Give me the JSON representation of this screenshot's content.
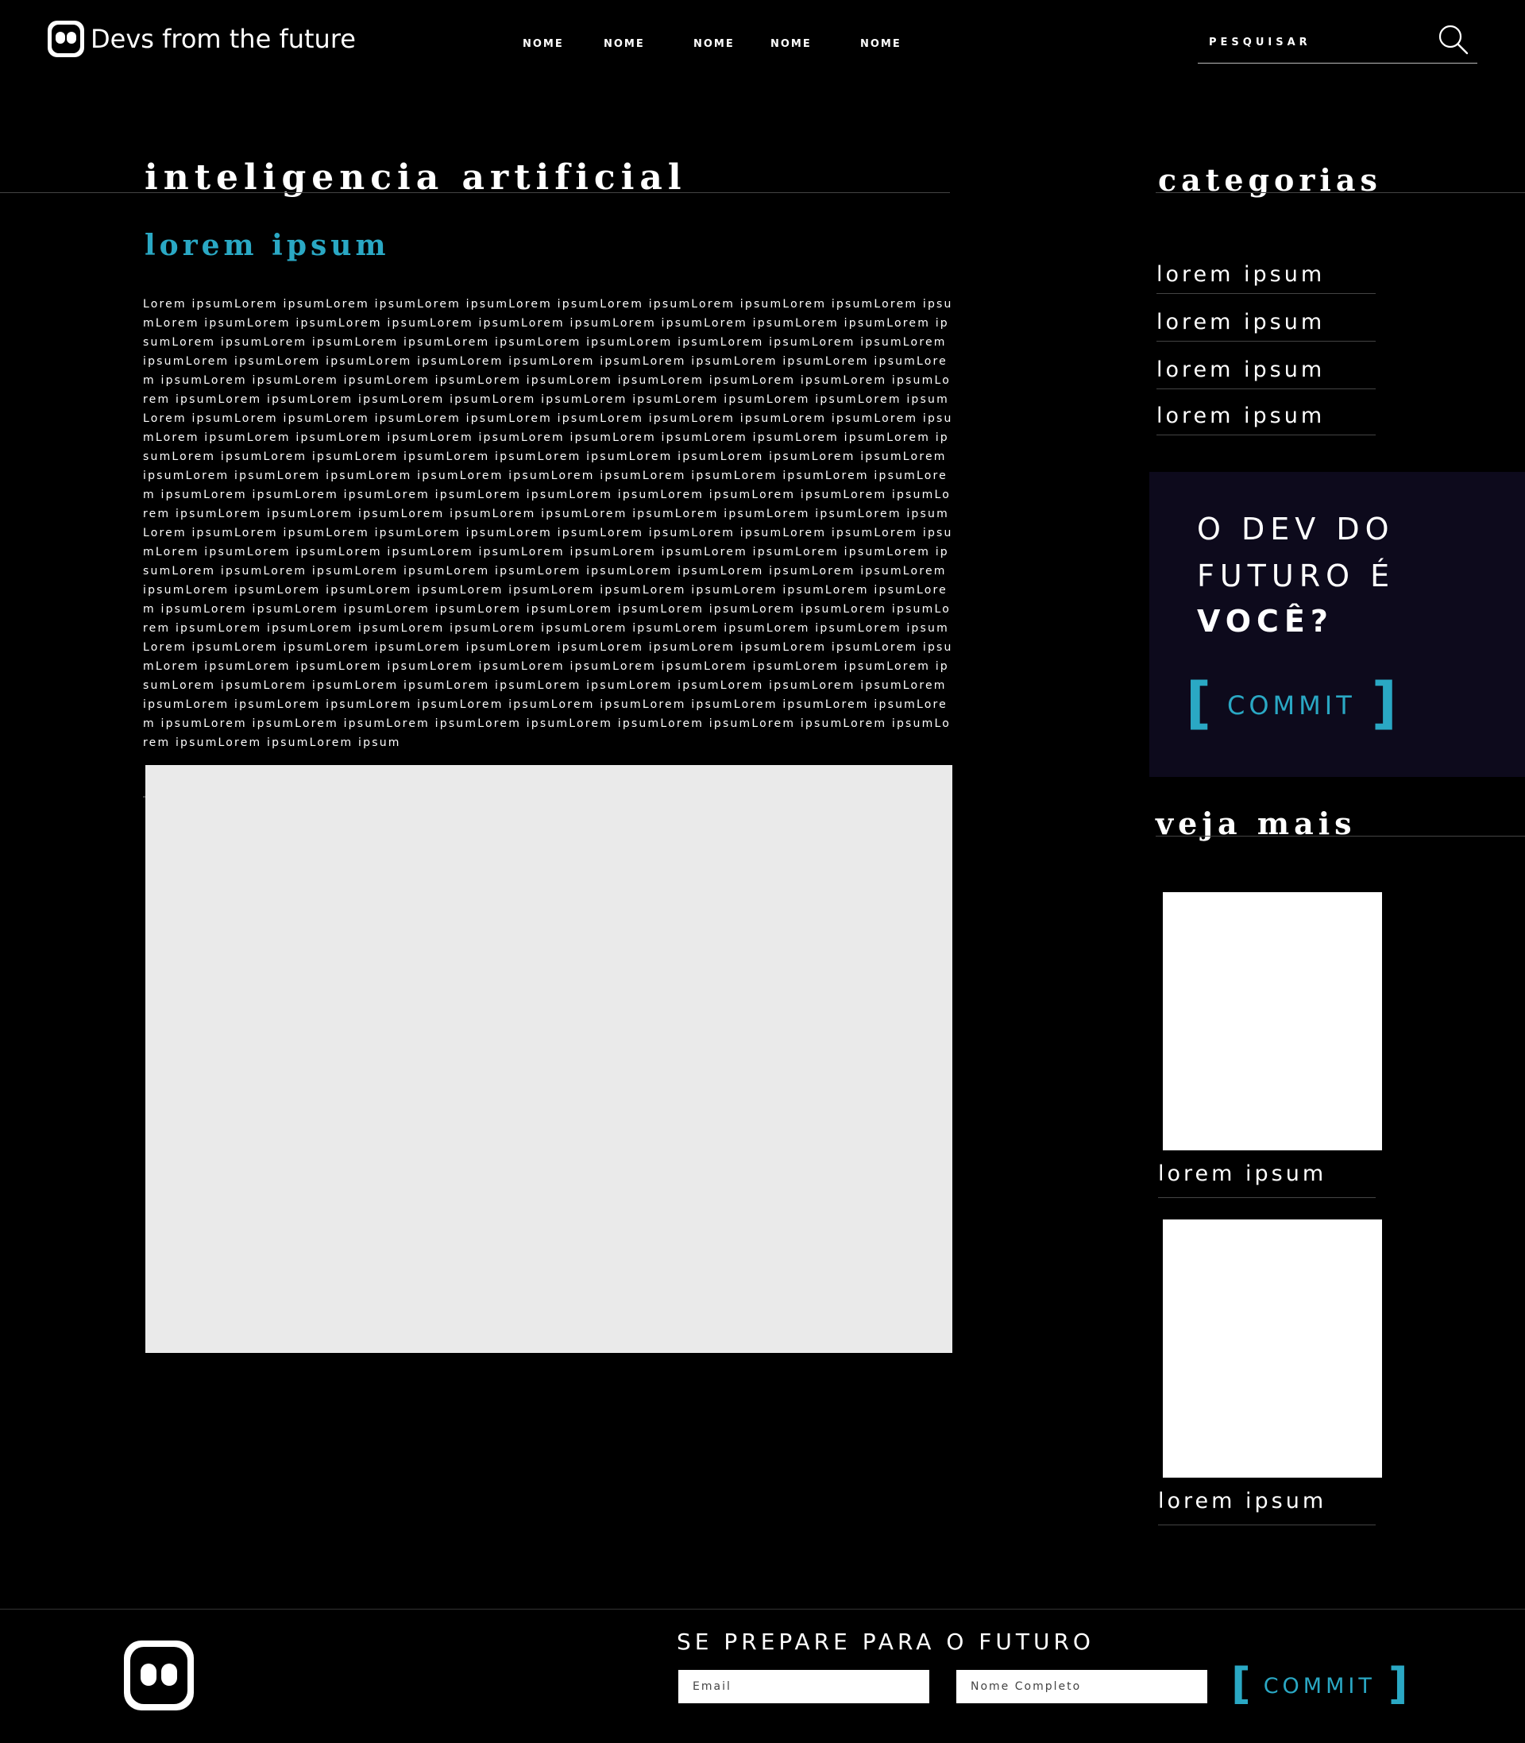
{
  "header": {
    "brand": "Devs from the future",
    "nav": [
      "NOME",
      "NOME",
      "NOME",
      "NOME",
      "NOME"
    ],
    "search_placeholder": "PESQUISAR"
  },
  "main": {
    "title": "inteligencia artificial",
    "subtitle": "lorem ipsum",
    "body": "Lorem ipsumLorem ipsumLorem ipsumLorem ipsumLorem ipsumLorem ipsumLorem ipsumLorem ipsumLorem ipsumLorem ipsumLorem ipsumLorem ipsumLorem ipsumLorem ipsumLorem ipsumLorem ipsumLorem ipsumLorem ipsumLorem ipsumLorem ipsumLorem ipsumLorem ipsumLorem ipsumLorem ipsumLorem ipsumLorem ipsumLorem ipsumLorem ipsumLorem ipsumLorem ipsumLorem ipsumLorem ipsumLorem ipsumLorem ipsumLorem ipsumLorem ipsumLorem ipsumLorem ipsumLorem ipsumLorem ipsumLorem ipsumLorem ipsumLorem ipsumLorem ipsumLorem ipsumLorem ipsumLorem ipsumLorem ipsumLorem ipsumLorem ipsumLorem ipsumLorem ipsumLorem ipsumLorem ipsumLorem ipsumLorem ipsumLorem ipsumLorem ipsumLorem ipsumLorem ipsumLorem ipsumLorem ipsumLorem ipsumLorem ipsumLorem ipsumLorem ipsumLorem ipsumLorem ipsumLorem ipsumLorem ipsumLorem ipsumLorem ipsumLorem ipsumLorem ipsumLorem ipsumLorem ipsumLorem ipsumLorem ipsumLorem ipsumLorem ipsumLorem ipsumLorem ipsumLorem ipsumLorem ipsumLorem ipsumLorem ipsumLorem ipsumLorem ipsumLorem ipsumLorem ipsumLorem ipsumLorem ipsumLorem ipsumLorem ipsumLorem ipsumLorem ipsumLorem ipsumLorem ipsumLorem ipsumLorem ipsumLorem ipsumLorem ipsumLorem ipsumLorem ipsumLorem ipsumLorem ipsumLorem ipsumLorem ipsumLorem ipsumLorem ipsumLorem ipsumLorem ipsumLorem ipsumLorem ipsumLorem ipsumLorem ipsumLorem ipsumLorem ipsumLorem ipsumLorem ipsumLorem ipsumLorem ipsumLorem ipsumLorem ipsumLorem ipsumLorem ipsumLorem ipsumLorem ipsumLorem ipsumLorem ipsumLorem ipsumLorem ipsumLorem ipsumLorem ipsumLorem ipsumLorem ipsumLorem ipsumLorem ipsumLorem ipsumLorem ipsumLorem ipsumLorem ipsumLorem ipsumLorem ipsumLorem ipsumLorem ipsumLorem ipsumLorem ipsumLorem ipsumLorem ipsumLorem ipsumLorem ipsumLorem ipsumLorem ipsumLorem ipsumLorem ipsumLorem ipsumLorem ipsumLorem ipsumLorem ipsumLorem ipsumLorem ipsumLorem ipsumLorem ipsumLorem ipsumLorem ipsumLorem ipsumLorem ipsumLorem ipsumLorem ipsumLorem ipsumLorem ipsumLorem ipsumLorem ipsumLorem ipsumLorem ipsumLorem ipsumLorem ipsumLorem ipsumLorem ipsumLorem ipsumLorem ipsumLorem ipsumLorem ipsumLorem ipsumLorem ipsumLorem ipsumLorem ipsumLorem ipsumLorem ipsumLorem ipsumLorem ipsumLorem ipsumLorem ipsumLorem ipsumLorem ipsumLorem ipsumLorem ipsumLorem ipsumLorem ipsumLorem ipsumLorem ipsumLorem ipsumLorem ipsumLorem ipsumLorem ipsum"
  },
  "sidebar": {
    "categories_title": "categorias",
    "categories": [
      "lorem ipsum",
      "lorem ipsum",
      "lorem ipsum",
      "lorem ipsum"
    ],
    "promo": {
      "line1": "O DEV DO",
      "line2": "FUTURO É",
      "line3": "VOCÊ?",
      "bracket_open": "[",
      "button": "COMMIT",
      "bracket_close": "]"
    },
    "more_title": "veja mais",
    "more_items": [
      "lorem ipsum",
      "lorem ipsum"
    ]
  },
  "footer": {
    "heading": "SE PREPARE PARA O FUTURO",
    "email_placeholder": "Email",
    "name_placeholder": "Nome Completo",
    "bracket_open": "[",
    "button": "COMMIT",
    "bracket_close": "]"
  },
  "colors": {
    "background": "#000000",
    "accent": "#2aa8c4",
    "promo_bg": "#0d0a1c",
    "image_placeholder": "#eaeaea"
  }
}
